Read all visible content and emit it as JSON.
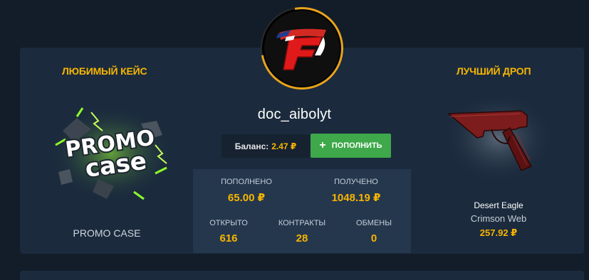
{
  "user": {
    "username": "doc_aibolyt",
    "avatar_icon": "faze-clan-logo-icon"
  },
  "favorite_case": {
    "title": "ЛЮБИМЫЙ КЕЙС",
    "name": "PROMO CASE",
    "logo_text_1": "PROMO",
    "logo_text_2": "case"
  },
  "best_drop": {
    "title": "ЛУЧШИЙ ДРОП",
    "weapon": "Desert Eagle",
    "skin": "Crimson Web",
    "price": "257.92 ₽"
  },
  "balance": {
    "label": "Баланс:",
    "value": "2.47 ₽"
  },
  "topup_button": {
    "label": "ПОПОЛНИТЬ",
    "icon": "plus-icon"
  },
  "stats": {
    "deposited_label": "ПОПОЛНЕНО",
    "deposited_value": "65.00 ₽",
    "received_label": "ПОЛУЧЕНО",
    "received_value": "1048.19 ₽",
    "opened_label": "ОТКРЫТО",
    "opened_value": "616",
    "contracts_label": "КОНТРАКТЫ",
    "contracts_value": "28",
    "trades_label": "ОБМЕНЫ",
    "trades_value": "0"
  },
  "colors": {
    "accent": "#f7b500",
    "button_green": "#3ea84a",
    "card_bg": "#1b2b3d",
    "page_bg": "#131d2a"
  }
}
